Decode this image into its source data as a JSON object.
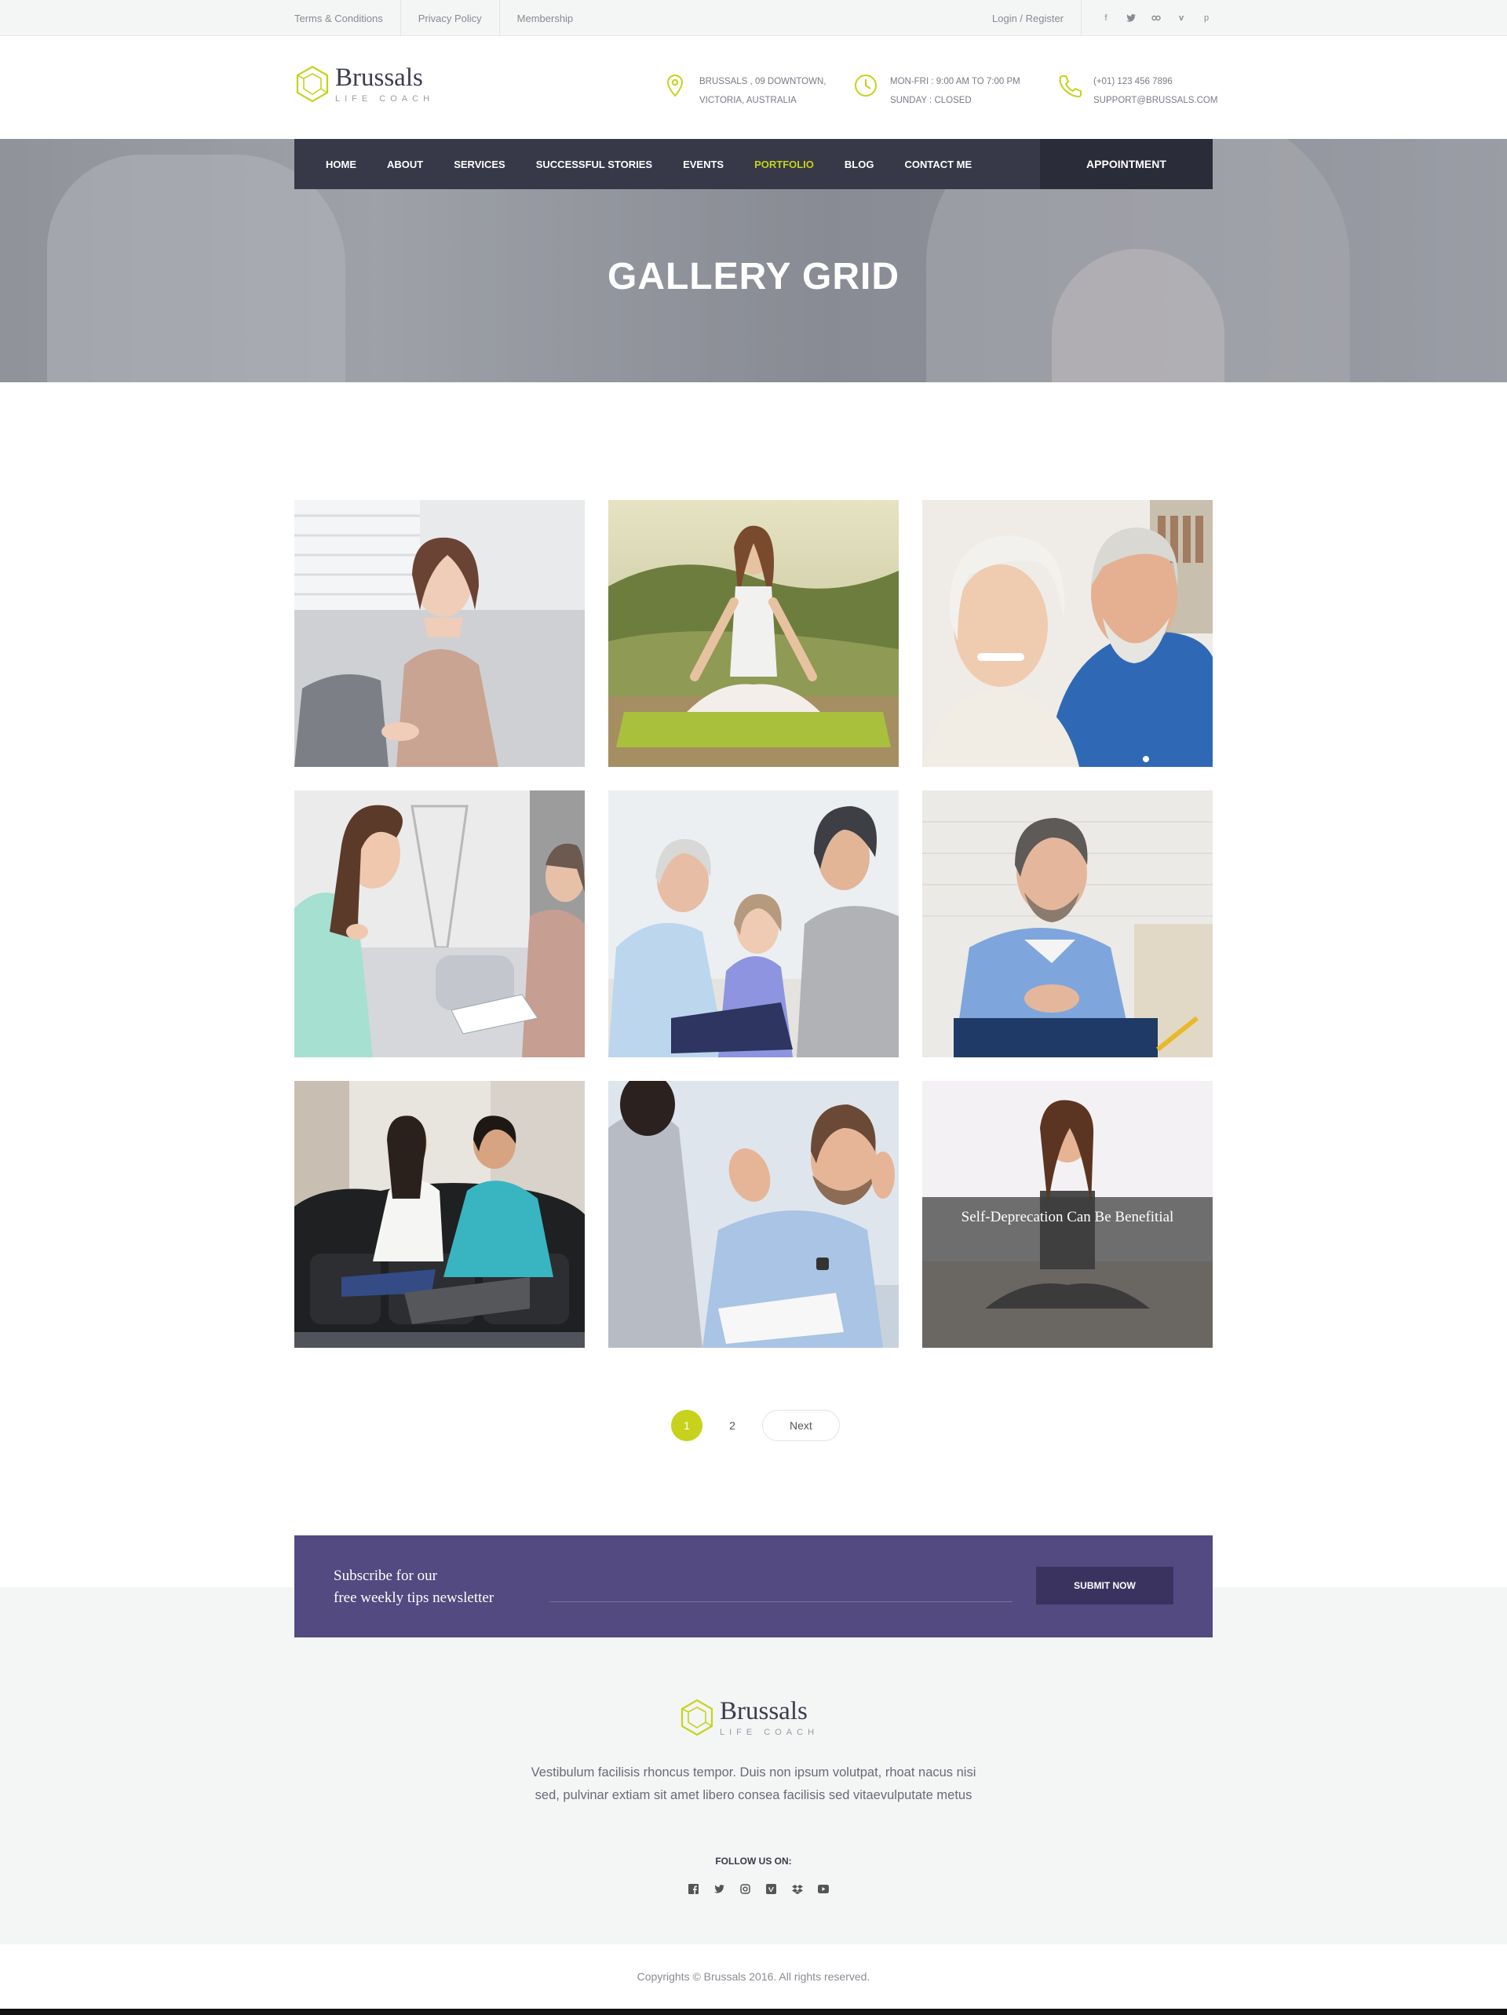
{
  "topbar": {
    "links": [
      "Terms & Conditions",
      "Privacy Policy",
      "Membership"
    ],
    "login": "Login / Register",
    "social_icons": [
      "facebook-icon",
      "twitter-icon",
      "link-icon",
      "vimeo-icon",
      "pinterest-icon"
    ]
  },
  "brand": {
    "name": "Brussals",
    "tagline": "LIFE COACH",
    "accent": "#c6d21b"
  },
  "header": {
    "address": {
      "line1": "BRUSSALS , 09 DOWNTOWN,",
      "line2": "VICTORIA, AUSTRALIA",
      "icon": "map-pin-icon"
    },
    "hours": {
      "line1": "MON-FRI : 9:00 AM TO 7:00 PM",
      "line2": "SUNDAY : CLOSED",
      "icon": "clock-icon"
    },
    "contact": {
      "line1": "(+01) 123 456 7896",
      "line2": "SUPPORT@BRUSSALS.COM",
      "icon": "phone-icon"
    }
  },
  "nav": {
    "items": [
      "HOME",
      "ABOUT",
      "SERVICES",
      "SUCCESSFUL STORIES",
      "EVENTS",
      "PORTFOLIO",
      "BLOG",
      "CONTACT ME"
    ],
    "active": "PORTFOLIO",
    "appointment": "APPOINTMENT",
    "bg": "#373848"
  },
  "hero": {
    "title": "GALLERY GRID"
  },
  "gallery": {
    "overlay_caption": "Self-Deprecation Can Be Benefitial"
  },
  "pagination": {
    "pages": [
      "1",
      "2"
    ],
    "current": "1",
    "next": "Next"
  },
  "subscribe": {
    "line1": "Subscribe for our",
    "line2": "free weekly tips newsletter",
    "button": "SUBMIT NOW",
    "bg": "#524a80"
  },
  "footer": {
    "description": "Vestibulum facilisis rhoncus tempor. Duis non ipsum volutpat, rhoat nacus nisi sed, pulvinar extiam sit amet libero consea facilisis sed vitaevulputate metus",
    "follow_label": "FOLLOW US ON:",
    "social_icons": [
      "facebook-icon",
      "twitter-icon",
      "instagram-icon",
      "vimeo-icon",
      "dropbox-icon",
      "youtube-icon"
    ],
    "copyright": "Copyrights © Brussals 2016. All rights reserved."
  }
}
